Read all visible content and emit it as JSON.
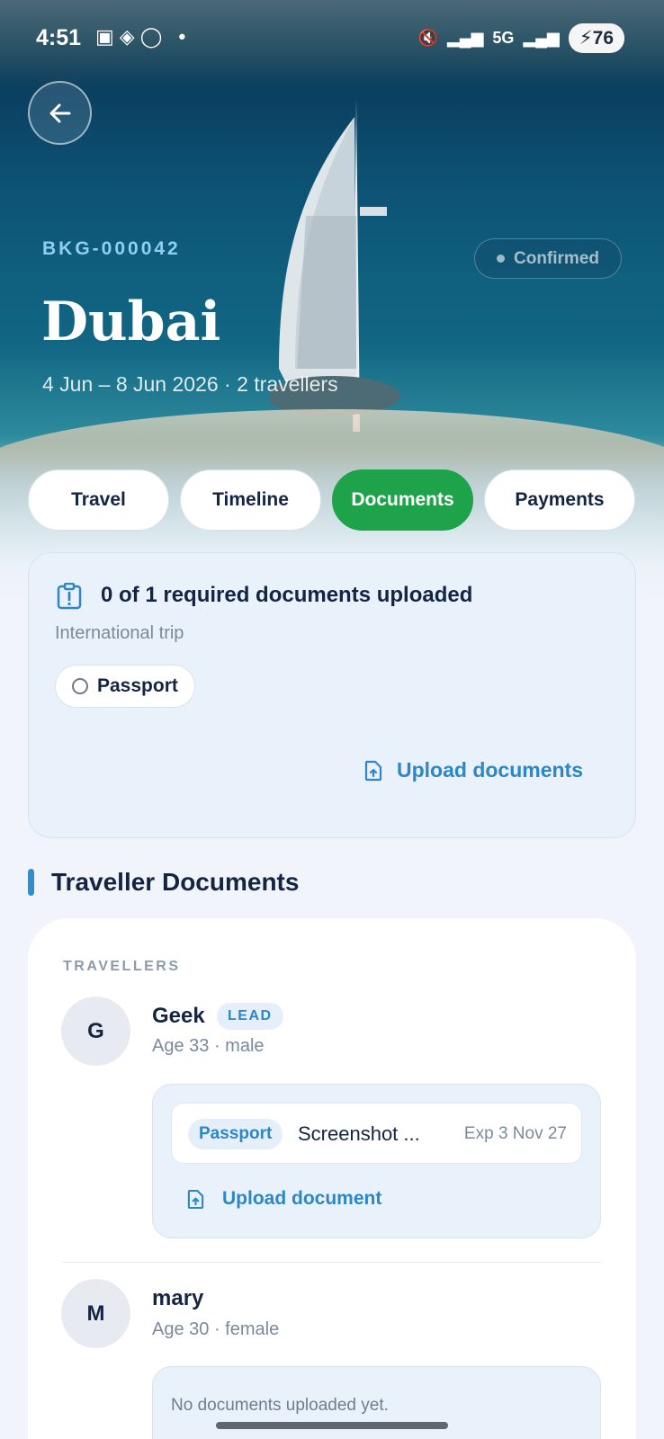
{
  "status_bar": {
    "time": "4:51",
    "battery": "76"
  },
  "hero": {
    "booking_id": "BKG-000042",
    "status": "Confirmed",
    "city": "Dubai",
    "trip_meta": "4 Jun – 8 Jun 2026 · 2 travellers"
  },
  "tabs": [
    {
      "label": "Travel",
      "active": false
    },
    {
      "label": "Timeline",
      "active": false
    },
    {
      "label": "Documents",
      "active": true
    },
    {
      "label": "Payments",
      "active": false
    }
  ],
  "summary": {
    "title": "0 of 1 required documents uploaded",
    "subtitle": "International trip",
    "required_docs": [
      "Passport"
    ],
    "upload_label": "Upload documents"
  },
  "section_title": "Traveller Documents",
  "travellers_label": "TRAVELLERS",
  "travellers": [
    {
      "initial": "G",
      "name": "Geek",
      "badge": "LEAD",
      "meta": "Age 33 · male",
      "documents": [
        {
          "type": "Passport",
          "file": "Screenshot ...",
          "expiry": "Exp 3 Nov 27"
        }
      ],
      "upload_label": "Upload document"
    },
    {
      "initial": "M",
      "name": "mary",
      "meta": "Age 30 · female",
      "empty_text": "No documents uploaded yet."
    }
  ],
  "colors": {
    "accent": "#1fa34a",
    "link": "#2d86c5",
    "text": "#142544",
    "card_bg": "#e9f1fb"
  }
}
